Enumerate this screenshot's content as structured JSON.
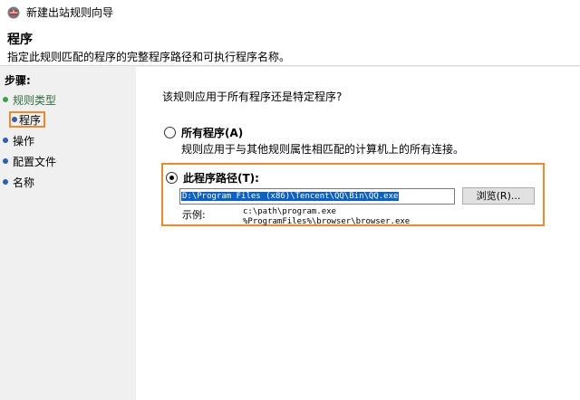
{
  "window": {
    "title": "新建出站规则向导"
  },
  "header": {
    "title": "程序",
    "description": "指定此规则匹配的程序的完整程序路径和可执行程序名称。"
  },
  "sidebar": {
    "heading": "步骤:",
    "steps": [
      {
        "label": "规则类型",
        "state": "done"
      },
      {
        "label": "程序",
        "state": "current"
      },
      {
        "label": "操作",
        "state": "pending"
      },
      {
        "label": "配置文件",
        "state": "pending"
      },
      {
        "label": "名称",
        "state": "pending"
      }
    ]
  },
  "main": {
    "question": "该规则应用于所有程序还是特定程序?",
    "option_all": {
      "label": "所有程序(A)",
      "description": "规则应用于与其他规则属性相匹配的计算机上的所有连接。",
      "checked": false
    },
    "option_path": {
      "label": "此程序路径(T):",
      "checked": true,
      "value": "D:\\Program Files (x86)\\Tencent\\QQ\\Bin\\QQ.exe",
      "browse_label": "浏览(R)...",
      "example_label": "示例:",
      "example_line1": "c:\\path\\program.exe",
      "example_line2": "%ProgramFiles%\\browser\\browser.exe"
    }
  },
  "colors": {
    "highlight_border": "#f08a26",
    "selection": "#0a62c9",
    "step_done_dot": "#3aa14a",
    "step_pending_dot": "#2b5fb8"
  }
}
